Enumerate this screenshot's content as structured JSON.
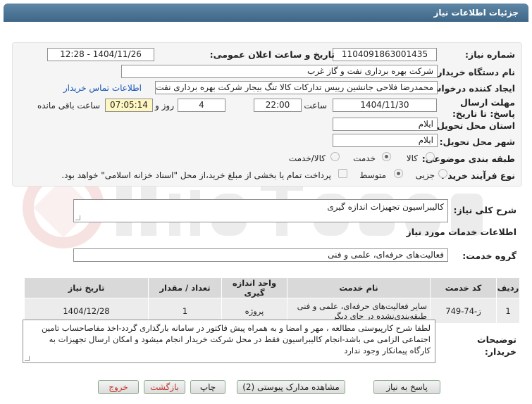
{
  "header": {
    "title": "جزئیات اطلاعات نیاز"
  },
  "form": {
    "need_number_label": "شماره نیاز:",
    "need_number": "1104091863001435",
    "announce_label": "تاریخ و ساعت اعلان عمومی:",
    "announce_value": "1404/11/26 - 12:28",
    "buyer_org_label": "نام دستگاه خریدار:",
    "buyer_org": "شرکت بهره برداری نفت و گاز غرب",
    "creator_label": "ایجاد کننده درخواست:",
    "creator": "محمدرضا فلاحی جانشین رییس تدارکات کالا تنگ بیجار شرکت بهره برداری نفت",
    "contact_link": "اطلاعات تماس خریدار",
    "deadline_label": "مهلت ارسال پاسخ: تا تاریخ:",
    "deadline_date": "1404/11/30",
    "time_label": "ساعت",
    "deadline_time": "22:00",
    "days_value": "4",
    "days_label": "روز و",
    "remaining_time": "07:05:14",
    "remaining_label": "ساعت باقی مانده",
    "province_label": "استان محل تحویل:",
    "province": "ایلام",
    "city_label": "شهر محل تحویل:",
    "city": "ایلام",
    "category_label": "طبقه بندی موضوعی:",
    "category_options": [
      "کالا",
      "خدمت",
      "کالا/خدمت"
    ],
    "category_selected": "خدمت",
    "process_label": "نوع فرآیند خرید :",
    "process_options": [
      "جزیی",
      "متوسط"
    ],
    "process_selected": "متوسط",
    "payment_note": "پرداخت تمام یا بخشی از مبلغ خرید،از محل \"اسناد خزانه اسلامی\" خواهد بود."
  },
  "summary": {
    "label": "شرح کلی نیاز:",
    "value": "کالیبراسیون تجهیزات اندازه گیری"
  },
  "services": {
    "section_title": "اطلاعات خدمات مورد نیاز",
    "group_label": "گروه خدمت:",
    "group_value": "فعالیت‌های حرفه‌ای، علمی و فنی"
  },
  "table": {
    "headers": [
      "ردیف",
      "کد خدمت",
      "نام خدمت",
      "واحد اندازه گیری",
      "تعداد / مقدار",
      "تاریخ نیاز"
    ],
    "rows": [
      [
        "1",
        "ز-74-749",
        "سایر فعالیت‌های حرفه‌ای، علمی و فنی طبقه‌بندی‌نشده در جای دیگر",
        "پروژه",
        "1",
        "1404/12/28"
      ]
    ]
  },
  "buyer_notes": {
    "label": "توضیحات خریدار:",
    "text": "لطفا شرح کارپیوستی مطالعه ، مهر و امضا و  به همراه پیش فاکتور در سامانه بارگذاری گردد-اخذ مفاصاحساب تامین اجتماعی الزامی می باشد-انجام کالیبراسیون فقط در محل شرکت خریدار انجام میشود و امکان ارسال تجهیزات به کارگاه پیمانکار وجود ندارد"
  },
  "buttons": {
    "reply": "پاسخ به نیاز",
    "attachments": "مشاهده مدارک پیوستی (2)",
    "print": "چاپ",
    "back": "بازگشت",
    "exit": "خروج"
  },
  "colors": {
    "header_bg": "#4a7497",
    "link": "#1a56b8",
    "highlight_field": "#fff7c2",
    "exit_text": "#c0392b"
  }
}
